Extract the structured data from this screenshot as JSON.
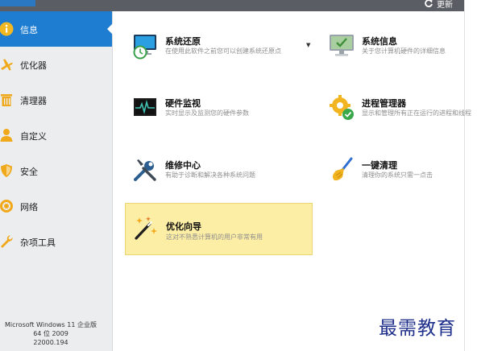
{
  "header": {
    "update_label": "更新"
  },
  "sidebar": {
    "items": [
      {
        "label": "信息",
        "icon": "info-icon",
        "active": true
      },
      {
        "label": "优化器",
        "icon": "airplane-icon"
      },
      {
        "label": "清理器",
        "icon": "trash-icon"
      },
      {
        "label": "自定义",
        "icon": "user-icon"
      },
      {
        "label": "安全",
        "icon": "shield-icon"
      },
      {
        "label": "网络",
        "icon": "globe-icon"
      },
      {
        "label": "杂项工具",
        "icon": "wrench-icon"
      }
    ],
    "system_info": [
      "Microsoft Windows 11 企业版",
      "64 位 2009",
      "22000.194"
    ]
  },
  "tools": [
    {
      "title": "系统还原",
      "desc": "在使用此软件之前您可以创建系统还原点",
      "icon": "system-restore-icon"
    },
    {
      "title": "系统信息",
      "desc": "关于您计算机硬件的详细信息",
      "icon": "system-info-icon"
    },
    {
      "title": "硬件监视",
      "desc": "实时显示及监测您的硬件参数",
      "icon": "hardware-monitor-icon"
    },
    {
      "title": "进程管理器",
      "desc": "显示和管理所有正在运行的进程和线程",
      "icon": "process-manager-icon"
    },
    {
      "title": "维修中心",
      "desc": "有助于诊断和解决各种系统问题",
      "icon": "repair-center-icon"
    },
    {
      "title": "一键清理",
      "desc": "清理你的系统只需一点击",
      "icon": "one-click-clean-icon"
    },
    {
      "title": "优化向导",
      "desc": "这对不熟悉计算机的用户非常有用",
      "icon": "wizard-icon"
    }
  ],
  "watermark": "最需教育",
  "colors": {
    "accent": "#1e7dd1",
    "highlight": "#fdeea5",
    "sidebar_bg": "#ecedef",
    "topbar": "#5a5d63"
  }
}
